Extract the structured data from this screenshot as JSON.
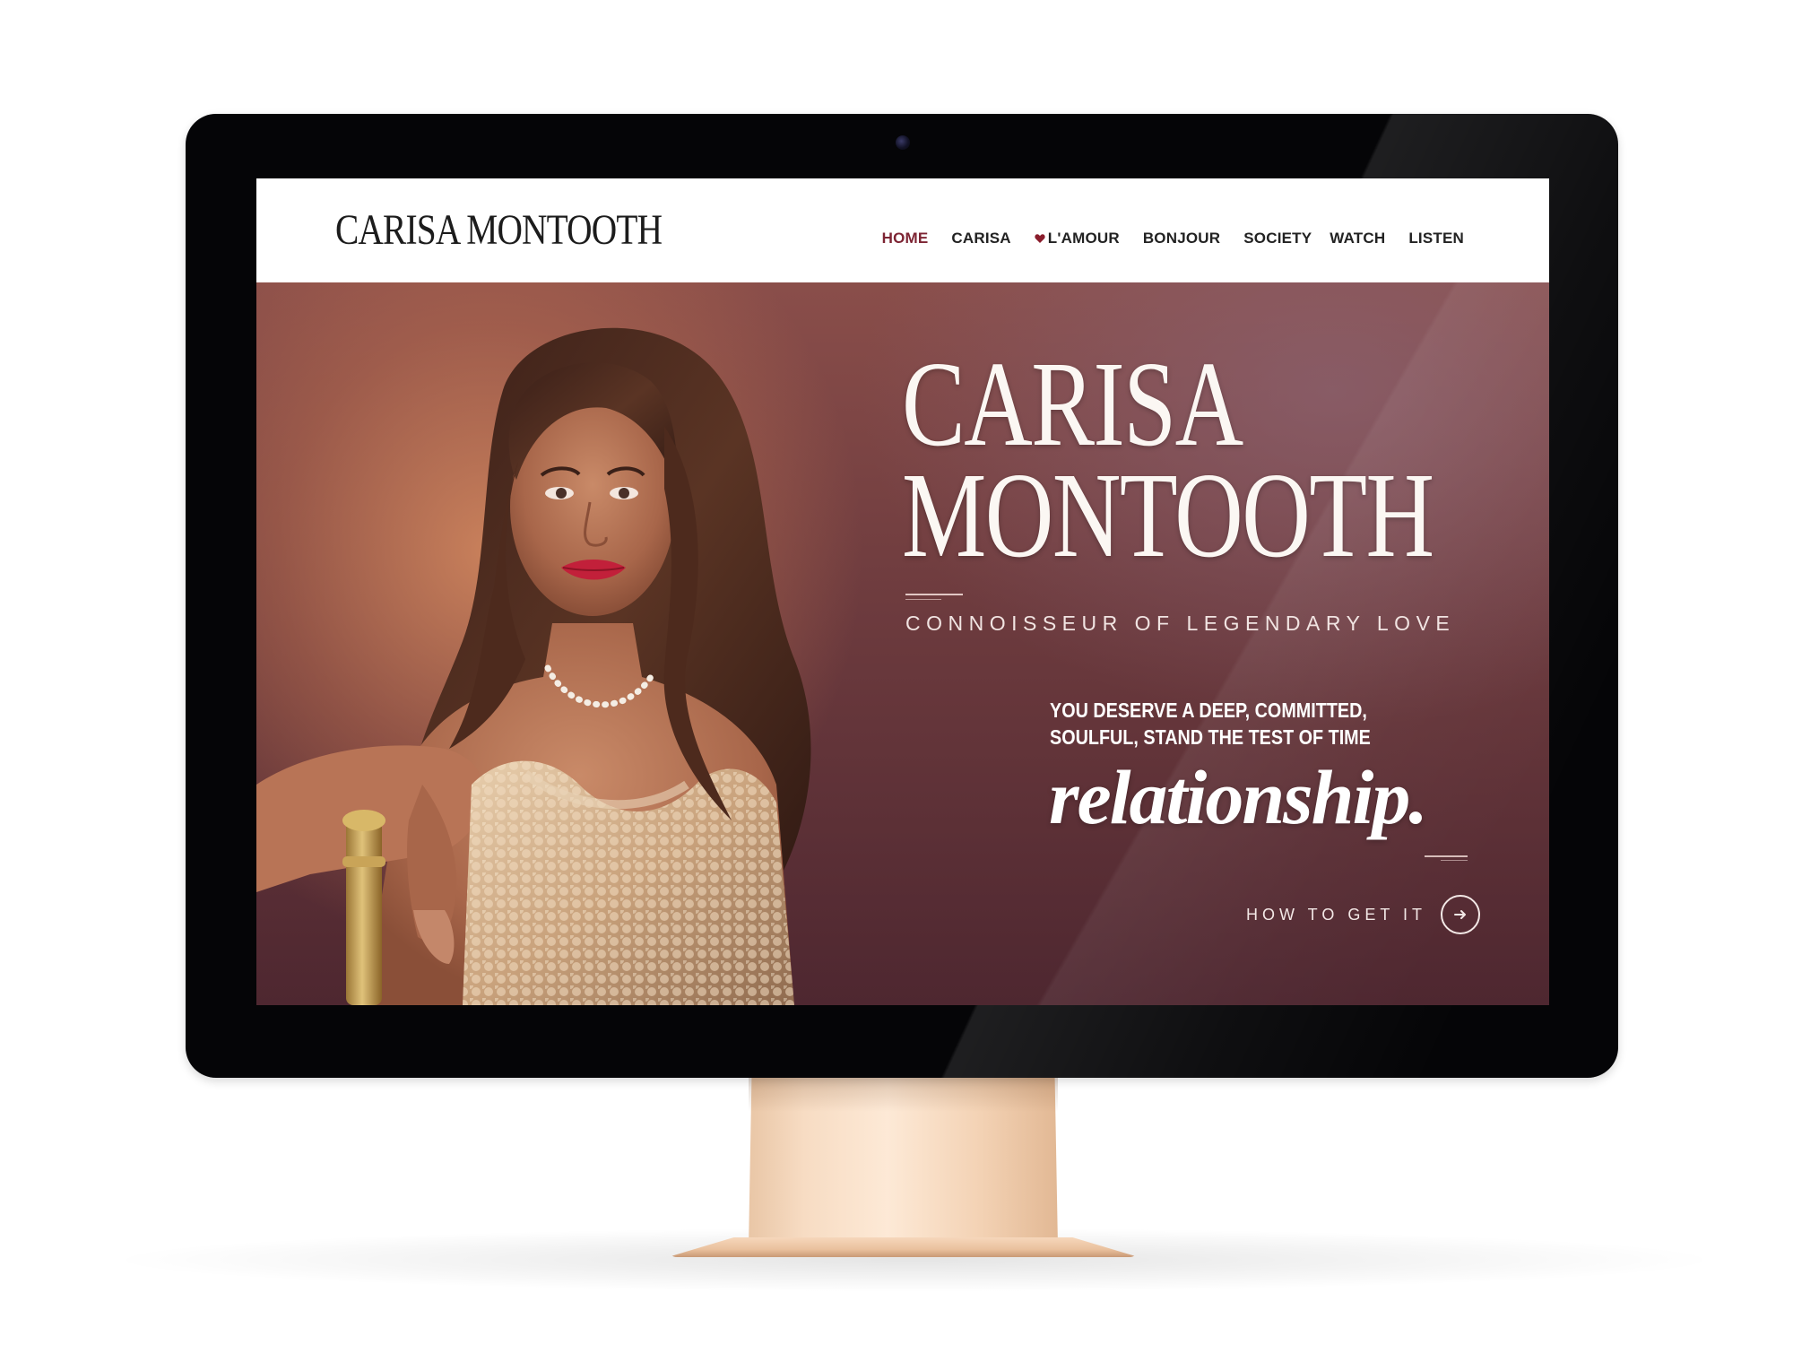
{
  "site": {
    "logo": "CARISA MONTOOTH"
  },
  "nav": {
    "items": [
      {
        "label": "HOME",
        "active": true
      },
      {
        "label": "CARISA",
        "active": false
      },
      {
        "label": "L'AMOUR",
        "active": false,
        "icon": "heart-icon"
      },
      {
        "label": "BONJOUR",
        "active": false
      },
      {
        "label": "SOCIETY",
        "active": false
      },
      {
        "label": "WATCH",
        "active": false
      },
      {
        "label": "LISTEN",
        "active": false
      }
    ]
  },
  "hero": {
    "title_line1": "CARISA",
    "title_line2": "MONTOOTH",
    "tagline": "CONNOISSEUR OF LEGENDARY LOVE",
    "pitch_line1": "YOU DESERVE A DEEP, COMMITTED,",
    "pitch_line2": "SOULFUL, STAND THE TEST OF TIME",
    "pitch_script": "relationship.",
    "cta_label": "HOW TO GET IT",
    "cta_icon": "arrow-right-icon"
  },
  "colors": {
    "nav_active": "#7d2433",
    "heart": "#8a1d2c",
    "hero_dark": "#4e2730",
    "hero_warm": "#d88c60",
    "bezel": "#050507",
    "stand": "#f7dcc3"
  }
}
